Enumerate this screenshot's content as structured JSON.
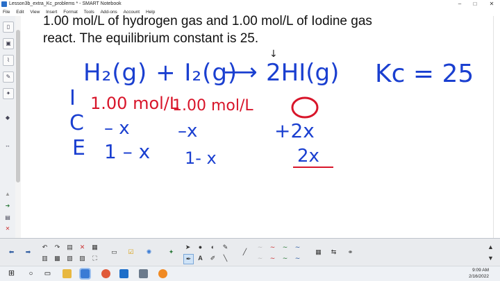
{
  "window": {
    "title": "Lesson3b_extra_Kc_problems * - SMART Notebook",
    "controls": [
      "–",
      "□",
      "✕"
    ]
  },
  "menu": [
    "File",
    "Edit",
    "View",
    "Insert",
    "Format",
    "Tools",
    "Add-ons",
    "Account",
    "Help"
  ],
  "question": {
    "line1": "1.00 mol/L of hydrogen gas and 1.00 mol/L of Iodine gas",
    "line2": "react. The equilibrium constant is 25."
  },
  "handwriting": {
    "reaction_left": "H₂(g) + I₂(g)",
    "arrow": "⟶",
    "reaction_right": "2HI(g)",
    "kc": "Kc = 25",
    "ice_rows": [
      "I",
      "C",
      "E"
    ],
    "initial_h2": "1.00 mol/L",
    "initial_i2": "1.00 mol/L",
    "change_h2": "– x",
    "change_i2": "–x",
    "change_hi": "+2x",
    "eq_h2": "1 – x",
    "eq_i2": "1- x",
    "eq_hi": "2x",
    "tick_mark": "↓"
  },
  "taskbar": {
    "search_icon": "search-icon",
    "time": "9:09 AM",
    "date": "2/16/2022"
  }
}
